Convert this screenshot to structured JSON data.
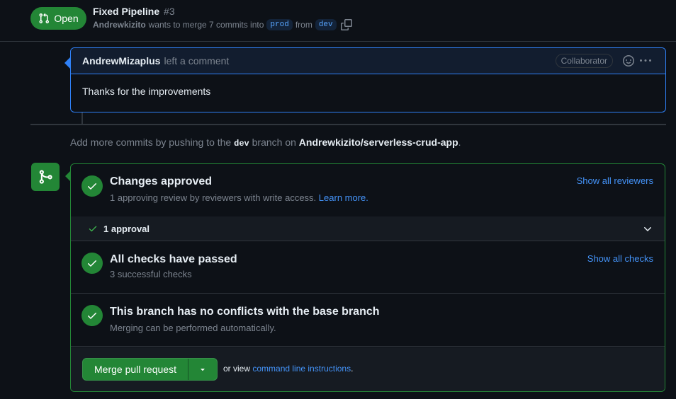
{
  "header": {
    "state": "Open",
    "title": "Fixed Pipeline",
    "number": "#3",
    "author": "Andrewkizito",
    "meta_text": "wants to merge 7 commits into",
    "base_branch": "prod",
    "from_text": "from",
    "head_branch": "dev"
  },
  "comment": {
    "author": "AndrewMizaplus",
    "action": "left a comment",
    "badge": "Collaborator",
    "body": "Thanks for the improvements"
  },
  "hint": {
    "prefix": "Add more commits by pushing to the",
    "branch": "dev",
    "middle": "branch on",
    "repo": "Andrewkizito/serverless-crud-app",
    "suffix": "."
  },
  "merge": {
    "approved": {
      "title": "Changes approved",
      "subtitle": "1 approving review by reviewers with write access.",
      "learn_more": "Learn more.",
      "link": "Show all reviewers"
    },
    "approval_row": "1 approval",
    "checks": {
      "title": "All checks have passed",
      "subtitle": "3 successful checks",
      "link": "Show all checks"
    },
    "conflicts": {
      "title": "This branch has no conflicts with the base branch",
      "subtitle": "Merging can be performed automatically."
    },
    "button_label": "Merge pull request",
    "or_view": "or view",
    "cli_link": "command line instructions",
    "cli_suffix": "."
  },
  "colors": {
    "accent_green": "#238636",
    "link_blue": "#4493f8",
    "focus_blue": "#2f81f7",
    "background": "#0d1117"
  },
  "icons": [
    "git-pull-request-icon",
    "copy-icon",
    "smiley-icon",
    "kebab-horizontal-icon",
    "git-merge-icon",
    "check-icon",
    "chevron-down-icon",
    "triangle-down-icon"
  ]
}
